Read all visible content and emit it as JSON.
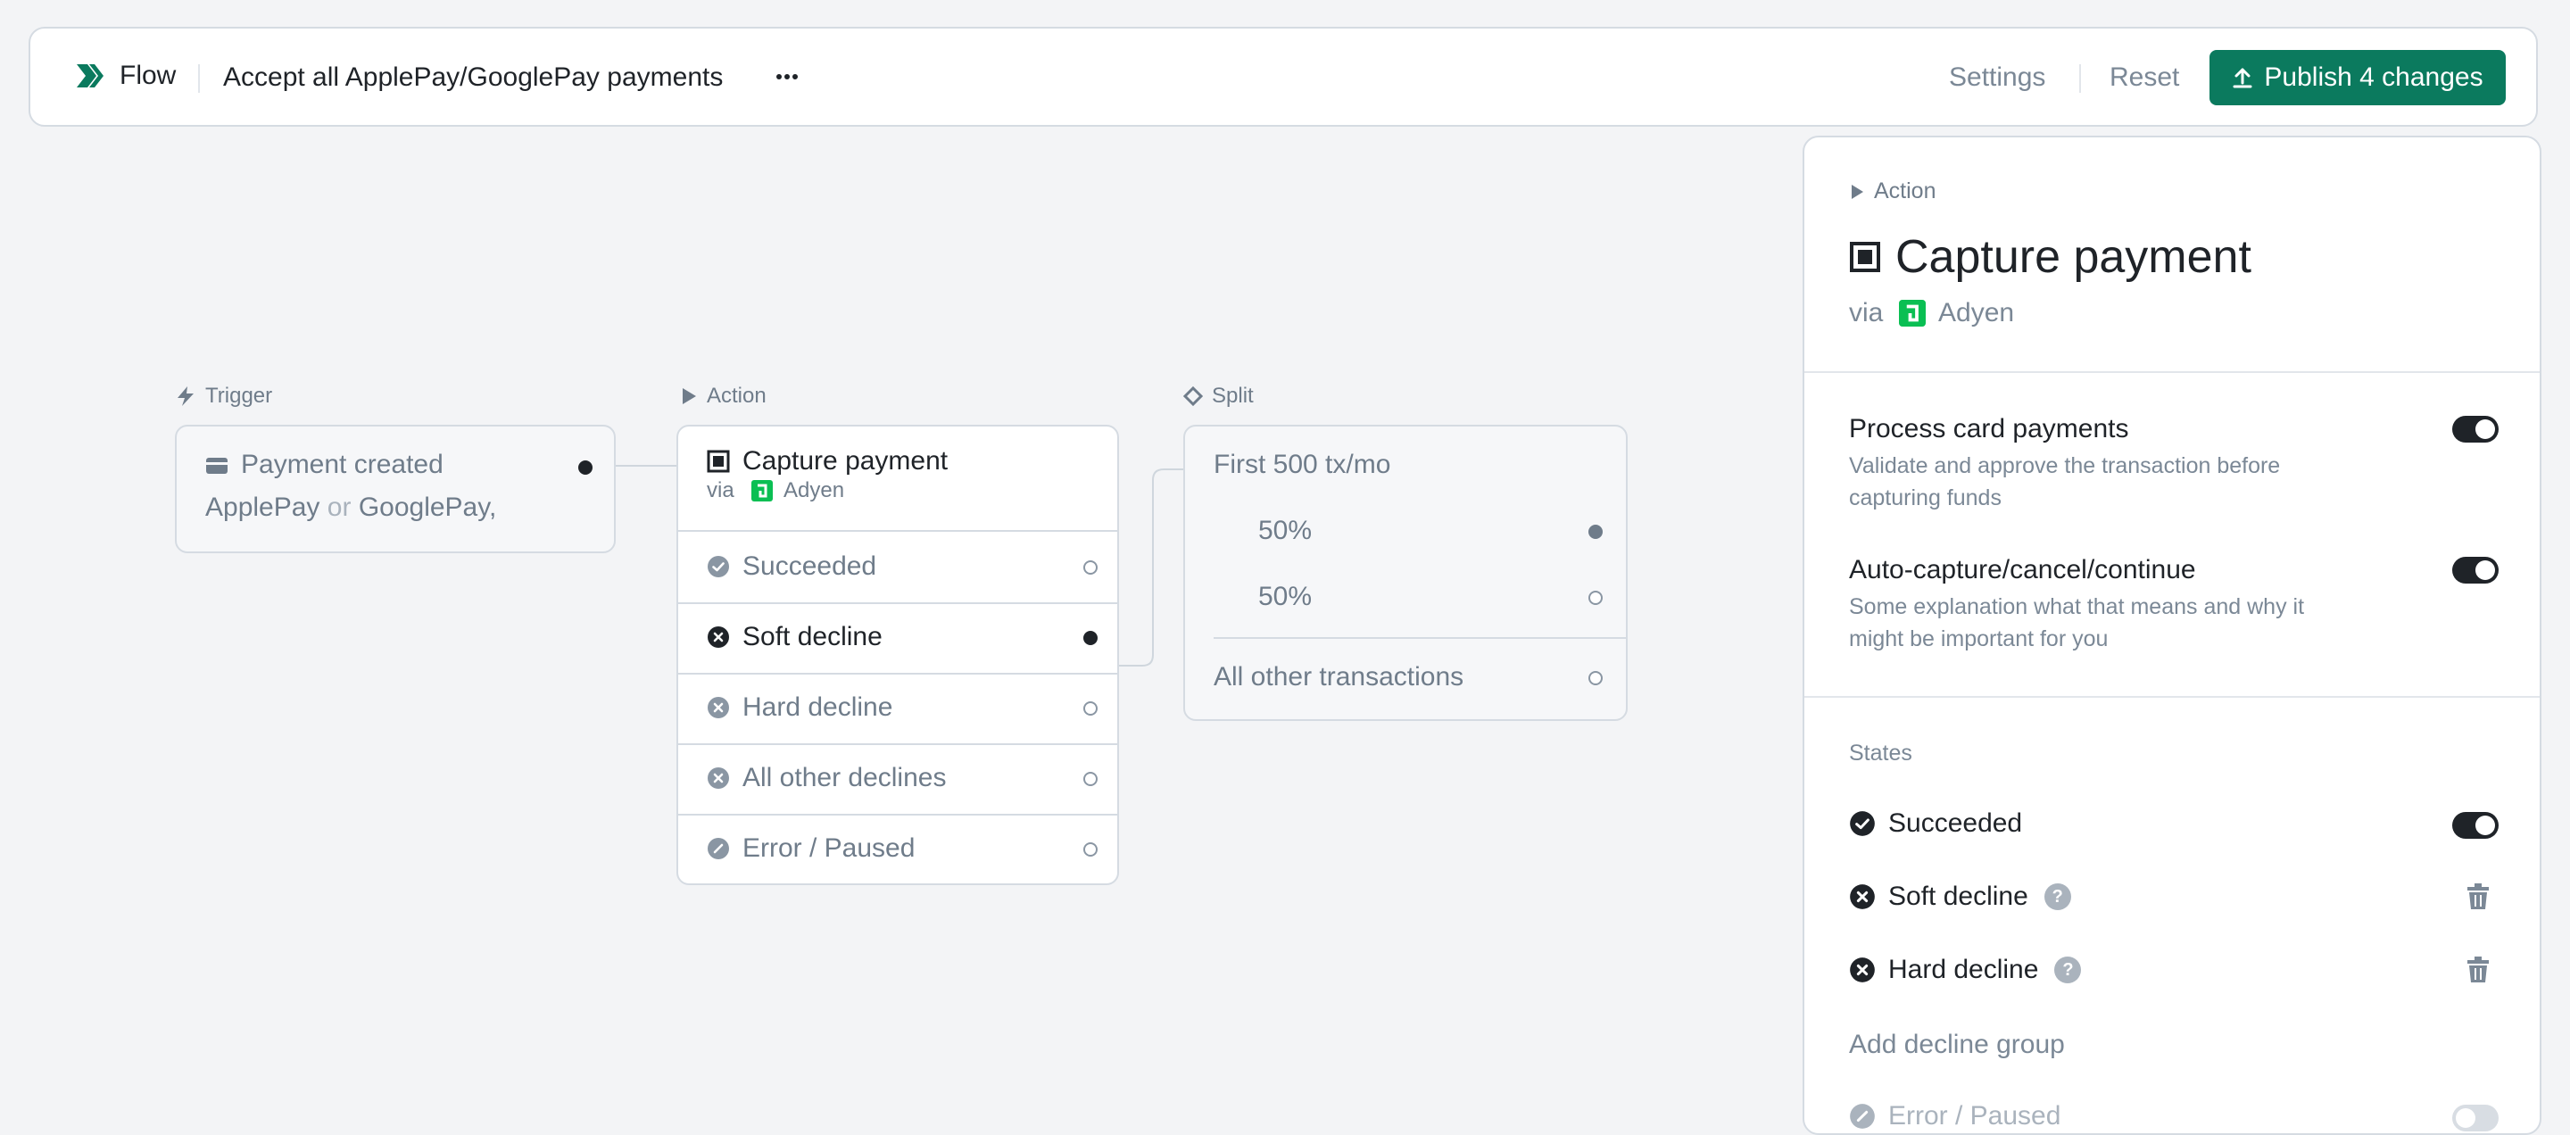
{
  "header": {
    "brand": "Flow",
    "flow_name": "Accept all ApplePay/GooglePay payments",
    "more_label": "···",
    "settings_label": "Settings",
    "reset_label": "Reset",
    "publish_label": "Publish 4 changes"
  },
  "canvas": {
    "trigger": {
      "label": "Trigger",
      "title": "Payment created",
      "condition_a": "ApplePay",
      "condition_or": "or",
      "condition_b": "GooglePay,"
    },
    "action": {
      "label": "Action",
      "title": "Capture payment",
      "via": "via",
      "provider": "Adyen",
      "outcomes": [
        {
          "label": "Succeeded",
          "icon": "check-circle-icon",
          "connected": false
        },
        {
          "label": "Soft decline",
          "icon": "x-circle-icon",
          "connected": true
        },
        {
          "label": "Hard decline",
          "icon": "x-circle-icon",
          "connected": false
        },
        {
          "label": "All other declines",
          "icon": "x-circle-icon",
          "connected": false
        },
        {
          "label": "Error / Paused",
          "icon": "slash-circle-icon",
          "connected": false
        }
      ]
    },
    "split": {
      "label": "Split",
      "group_title": "First 500 tx/mo",
      "branches": [
        "50%",
        "50%"
      ],
      "other": "All other transactions"
    }
  },
  "panel": {
    "breadcrumb": "Action",
    "title": "Capture payment",
    "via": "via",
    "provider": "Adyen",
    "settings": [
      {
        "title": "Process card payments",
        "description": "Validate and approve the transaction before capturing funds",
        "enabled": true
      },
      {
        "title": "Auto-capture/cancel/continue",
        "description": "Some explanation what that means and why it might be important for you",
        "enabled": true
      }
    ],
    "states_heading": "States",
    "states": [
      {
        "label": "Succeeded",
        "control": "toggle",
        "enabled": true
      },
      {
        "label": "Soft decline",
        "control": "delete",
        "help": true
      },
      {
        "label": "Hard decline",
        "control": "delete",
        "help": true
      }
    ],
    "add_decline_group": "Add decline group",
    "error_state": {
      "label": "Error / Paused",
      "enabled": false
    }
  },
  "colors": {
    "background": "#f3f4f6",
    "accent": "#0b7a5e",
    "provider_green": "#0abf53",
    "text_dark": "#1f2328",
    "text_muted": "#6f7c8a",
    "border": "#d5dbe2"
  }
}
